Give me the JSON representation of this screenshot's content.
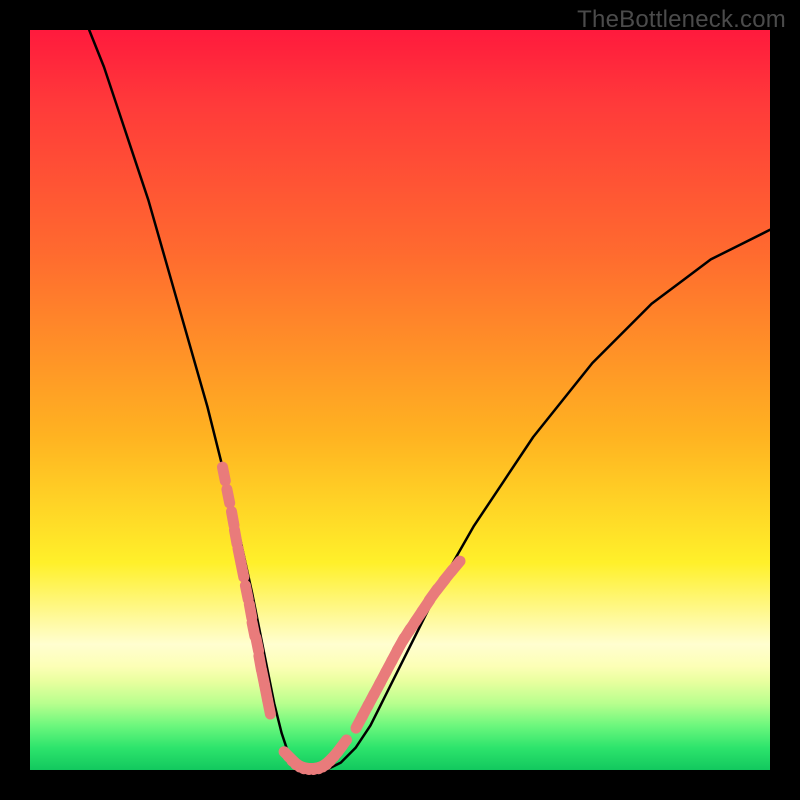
{
  "watermark": "TheBottleneck.com",
  "chart_data": {
    "type": "line",
    "title": "",
    "xlabel": "",
    "ylabel": "",
    "xlim": [
      0,
      100
    ],
    "ylim": [
      0,
      100
    ],
    "grid": false,
    "legend": false,
    "series": [
      {
        "name": "bottleneck-curve",
        "color": "#000000",
        "x": [
          8,
          10,
          12,
          14,
          16,
          18,
          20,
          22,
          24,
          26,
          28,
          30,
          31,
          32,
          33,
          34,
          35,
          36,
          38,
          40,
          42,
          44,
          46,
          48,
          52,
          56,
          60,
          64,
          68,
          72,
          76,
          80,
          84,
          88,
          92,
          96,
          100
        ],
        "y": [
          100,
          95,
          89,
          83,
          77,
          70,
          63,
          56,
          49,
          41,
          33,
          24,
          19,
          14,
          9,
          5,
          2,
          1,
          0,
          0,
          1,
          3,
          6,
          10,
          18,
          26,
          33,
          39,
          45,
          50,
          55,
          59,
          63,
          66,
          69,
          71,
          73
        ]
      },
      {
        "name": "highlight-dots-left",
        "color": "#e97b7b",
        "x": [
          26.2,
          26.8,
          27.4,
          27.8,
          28.3,
          28.7,
          29.3,
          29.8,
          30.2,
          30.7,
          31.1,
          31.5,
          31.9,
          32.3
        ],
        "y": [
          40,
          37,
          34,
          31.5,
          29,
          27,
          24,
          21.5,
          19,
          17,
          14.5,
          12.5,
          10.5,
          8.5
        ]
      },
      {
        "name": "highlight-dots-bottom",
        "color": "#e97b7b",
        "x": [
          35.0,
          35.6,
          36.2,
          36.8,
          37.4,
          38.0,
          38.6,
          39.2,
          39.8,
          40.4,
          41.0,
          41.6,
          42.2
        ],
        "y": [
          1.8,
          1.2,
          0.7,
          0.4,
          0.25,
          0.2,
          0.25,
          0.4,
          0.7,
          1.2,
          1.8,
          2.5,
          3.3
        ]
      },
      {
        "name": "highlight-dots-right",
        "color": "#e97b7b",
        "x": [
          44.5,
          45.3,
          46.1,
          46.9,
          47.7,
          48.5,
          49.3,
          50.1,
          50.9,
          51.7,
          52.5,
          53.5,
          54.5,
          55.5,
          56.5,
          57.5
        ],
        "y": [
          6.5,
          8.0,
          9.5,
          11.0,
          12.5,
          14.0,
          15.5,
          17.0,
          18.3,
          19.5,
          20.7,
          22.2,
          23.7,
          25.0,
          26.3,
          27.5
        ]
      }
    ]
  },
  "colors": {
    "curve": "#000000",
    "dots": "#e97b7b",
    "outer": "#000000"
  }
}
